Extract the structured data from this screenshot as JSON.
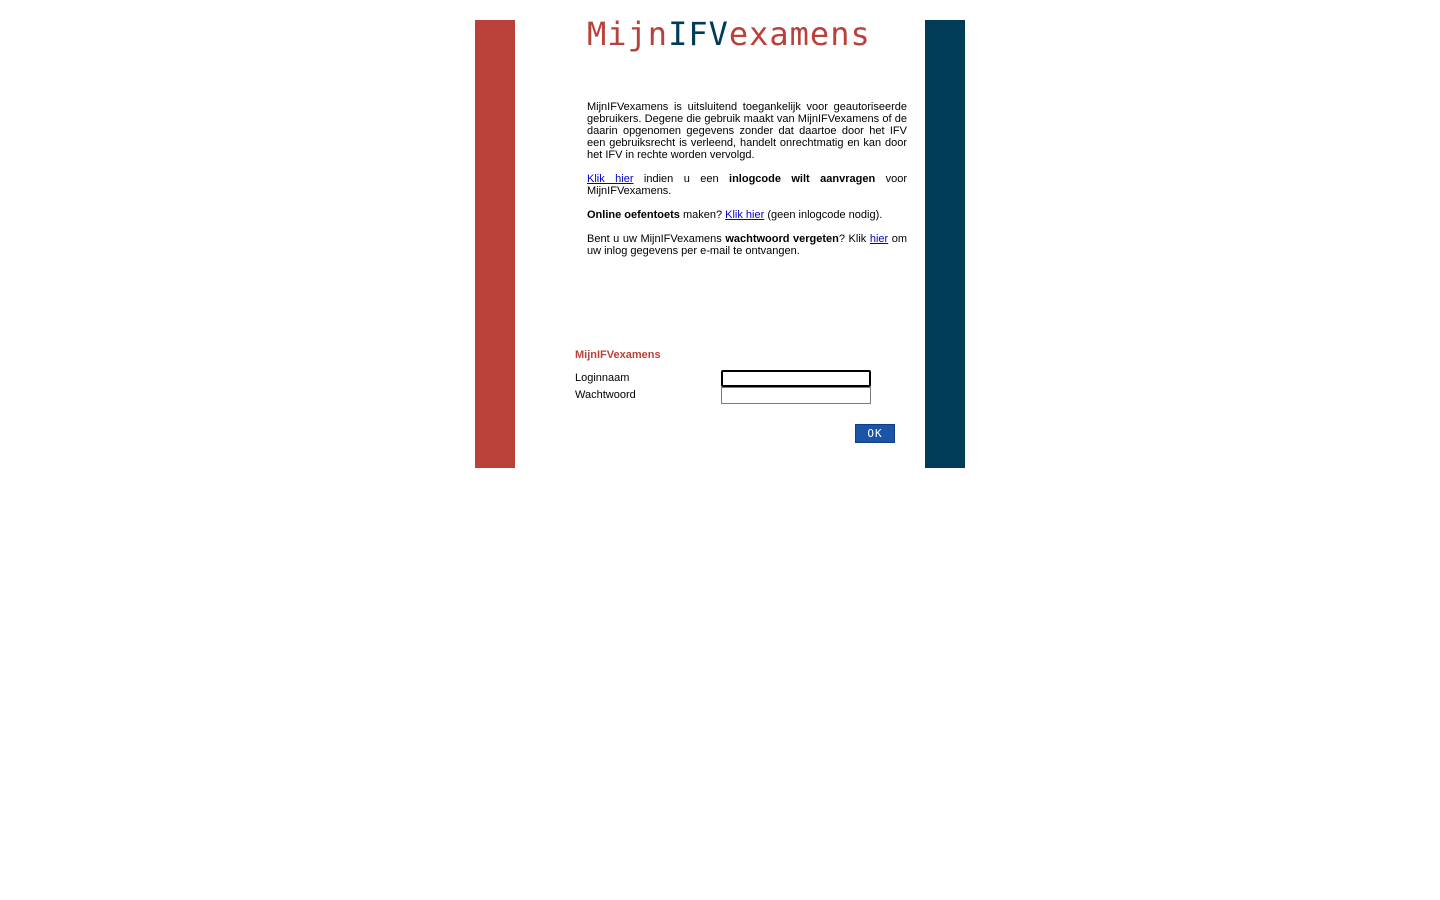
{
  "brand": {
    "logo_part1": "Mijn",
    "logo_part2": "IFV",
    "logo_part3": "examens",
    "color_red": "#b9413a",
    "color_blue": "#003b57"
  },
  "intro": {
    "disclaimer": "MijnIFVexamens is uitsluitend toegankelijk voor geautoriseerde gebruikers. Degene die gebruik maakt van MijnIFVexamens of de daarin opgenomen gegevens zonder dat daartoe door het IFV een gebruiksrecht is verleend, handelt onrechtmatig en kan door het IFV in rechte worden vervolgd.",
    "request": {
      "link": "Klik hier",
      "text1": " indien u een ",
      "bold": "inlogcode wilt aanvragen",
      "text2": " voor MijnIFVexamens."
    },
    "practice": {
      "bold": "Online oefentoets",
      "text1": " maken? ",
      "link": "Klik hier",
      "text2": " (geen inlogcode nodig)."
    },
    "forgot": {
      "text1": "Bent u uw MijnIFVexamens ",
      "bold": "wachtwoord vergeten",
      "text2": "? Klik ",
      "link": "hier",
      "text3": " om uw inlog gegevens per e-mail te ontvangen."
    }
  },
  "login": {
    "title": "MijnIFVexamens",
    "username_label": "Loginnaam",
    "username_value": "",
    "password_label": "Wachtwoord",
    "password_value": "",
    "ok_label": "OK"
  }
}
